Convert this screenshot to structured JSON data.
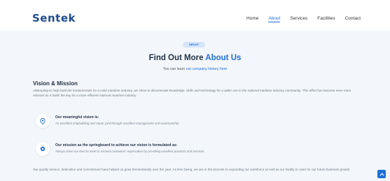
{
  "brand": {
    "logo_text": "Sentek",
    "accent_color": "#1f6fd6",
    "logo_color": "#1f4b8f"
  },
  "nav": {
    "items": [
      "Home",
      "About",
      "Services",
      "Facilities",
      "Contact"
    ],
    "active": "About"
  },
  "hero": {
    "badge": "ABOUT",
    "title_plain": "Find Out More ",
    "title_accent": "About Us",
    "sub_prefix": "You can learn ",
    "sub_link": "our company history here"
  },
  "vision": {
    "heading": "Vision & Mission",
    "intro": "Attempting to help build the fundamentals for a solid maritime industry, we strive to disseminate knowledge, skills and technology for a wider use in the national maritime industry community. This effort has become even more relevant as it holds the key for a more efficient national maritime industry."
  },
  "features": [
    {
      "icon": "location-pin-icon",
      "title": "Our meaningful vision is:",
      "text": "An excellent shipbuilding and repair yard through excellent management and workmanship."
    },
    {
      "icon": "target-dot-icon",
      "title": "Our mission as the springboard to achieve our vision is formulated as:",
      "text": "Always strive our best to meet or exceed customers' expectation by providing excellent products and services."
    }
  ],
  "closing": {
    "text": "Our quality service, dedication and commitment have helped us grow tremendously over the year. As time being, we are in the process to expanding our workforce as well as our facility to cater for our future business growth."
  },
  "scroll_top": {
    "icon": "chevron-up-icon"
  }
}
